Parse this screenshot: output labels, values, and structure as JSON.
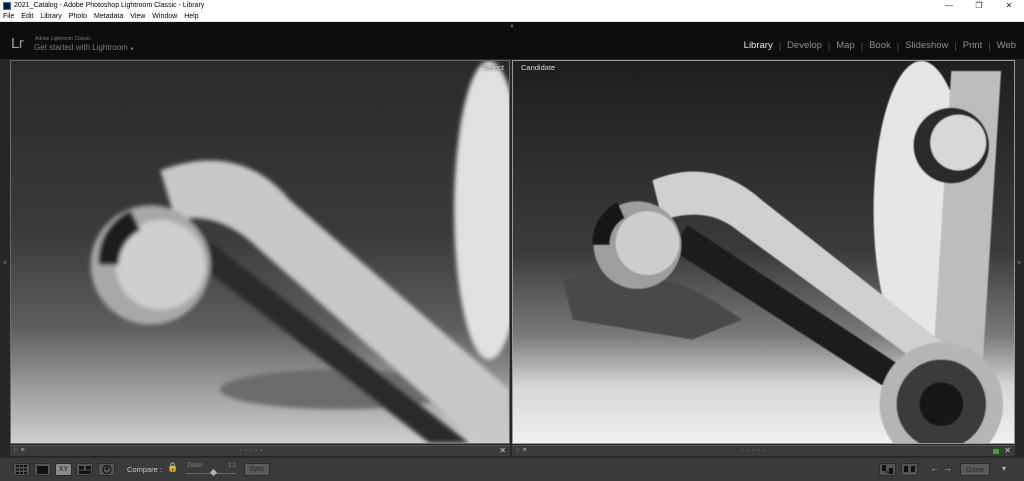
{
  "window": {
    "title": "2021_Catalog - Adobe Photoshop Lightroom Classic - Library",
    "minimize": "—",
    "maximize": "❐",
    "close": "✕"
  },
  "menu": [
    "File",
    "Edit",
    "Library",
    "Photo",
    "Metadata",
    "View",
    "Window",
    "Help"
  ],
  "header": {
    "logo": "Lr",
    "brand_small": "Adobe Lightroom Classic",
    "identity_plate": "Get started with Lightroom",
    "identity_arrow": "▸",
    "modules": [
      "Library",
      "Develop",
      "Map",
      "Book",
      "Slideshow",
      "Print",
      "Web"
    ],
    "active_module": "Library"
  },
  "compare": {
    "select_label": "Select",
    "candidate_label": "Candidate",
    "flag_glyph": "⚐ ⚑",
    "stars": "• • • • •",
    "close_glyph": "✕"
  },
  "toolbar": {
    "compare_label": "Compare :",
    "zoom_label": "Zoom",
    "zoom_ratio": "1:1",
    "zoom_level": 0.54,
    "sync_label": "Sync",
    "done_label": "Done",
    "prev_arrow": "←",
    "next_arrow": "→",
    "dropdown_arrow": "▾",
    "view_buttons": [
      "grid-view",
      "loupe-view",
      "compare-view",
      "survey-view",
      "people-view"
    ],
    "compare_view_text": "XY"
  },
  "colors": {
    "background": "#262626",
    "toolbar": "#3a3a3a",
    "active_module": "#e8e8e8",
    "inactive_module": "#8d8d8d",
    "candidate_flag": "#3fa63f"
  }
}
